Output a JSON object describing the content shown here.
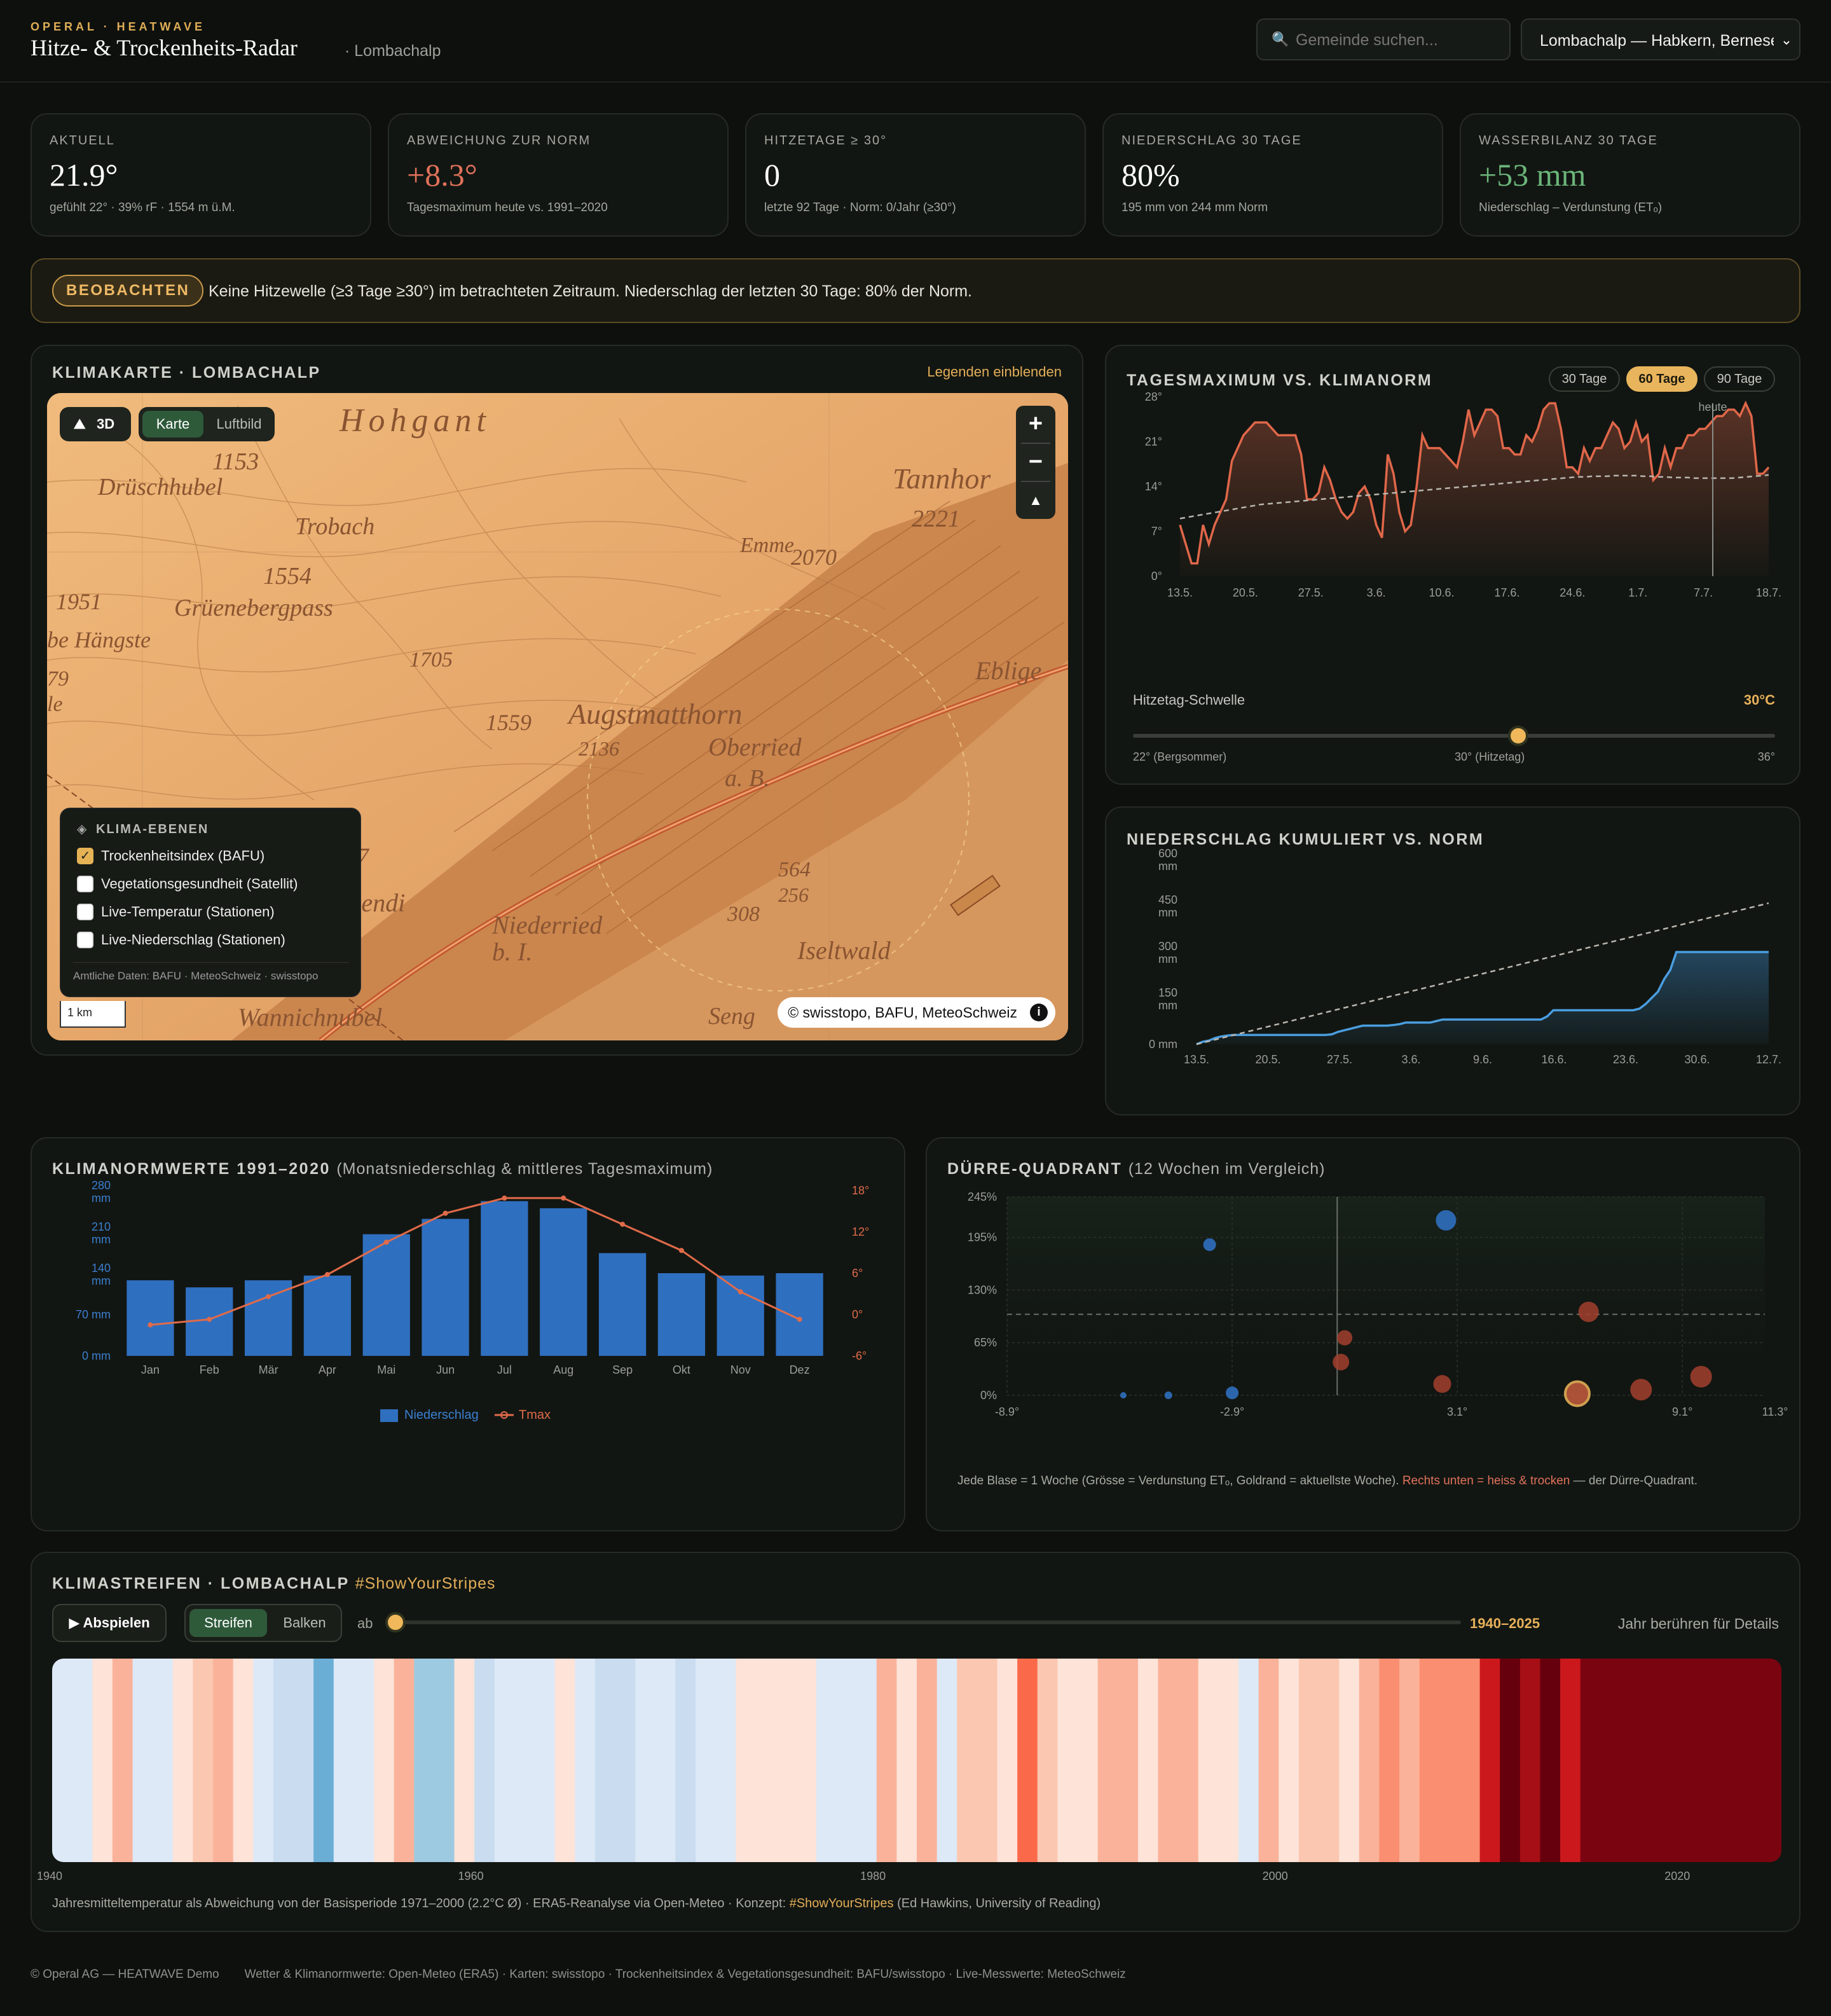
{
  "header": {
    "eyebrow": "OPERAL · HEATWAVE",
    "title": "Hitze- & Trockenheits-Radar",
    "subtitle": "· Lombachalp",
    "search_placeholder": "Gemeinde suchen...",
    "location_value": "Lombachalp — Habkern, Bernese"
  },
  "kpis": [
    {
      "label": "AKTUELL",
      "value": "21.9°",
      "note": "gefühlt 22° · 39% rF · 1554 m ü.M.",
      "color": "#ffffff"
    },
    {
      "label": "ABWEICHUNG ZUR NORM",
      "value": "+8.3°",
      "note": "Tagesmaximum heute vs. 1991–2020",
      "color": "#e0725a"
    },
    {
      "label": "HITZETAGE ≥ 30°",
      "value": "0",
      "note": "letzte 92 Tage · Norm: 0/Jahr (≥30°)",
      "color": "#ffffff"
    },
    {
      "label": "NIEDERSCHLAG 30 TAGE",
      "value": "80%",
      "note": "195 mm von 244 mm Norm",
      "color": "#ffffff"
    },
    {
      "label": "WASSERBILANZ 30 TAGE",
      "value": "+53 mm",
      "note": "Niederschlag – Verdunstung (ETₒ)",
      "color": "#6bb57a"
    }
  ],
  "alert": {
    "badge": "BEOBACHTEN",
    "text": "Keine Hitzewelle (≥3 Tage ≥30°) im betrachteten Zeitraum. Niederschlag der letzten 30 Tage: 80% der Norm."
  },
  "map": {
    "title": "KLIMAKARTE · LOMBACHALP",
    "legend_link": "Legenden einblenden",
    "btn_3d": "3D",
    "mode_map": "Karte",
    "mode_aerial": "Luftbild",
    "zoom_in": "+",
    "zoom_out": "−",
    "layers_title": "KLIMA-EBENEN",
    "layers": [
      {
        "label": "Trockenheitsindex (BAFU)",
        "checked": true
      },
      {
        "label": "Vegetationsgesundheit (Satellit)",
        "checked": false
      },
      {
        "label": "Live-Temperatur (Stationen)",
        "checked": false
      },
      {
        "label": "Live-Niederschlag (Stationen)",
        "checked": false
      }
    ],
    "layers_source": "Amtliche Daten: BAFU · MeteoSchweiz · swisstopo",
    "scale": "1 km",
    "attribution": "© swisstopo, BAFU, MeteoSchweiz",
    "info": "i",
    "places": [
      {
        "t": "Hohgant"
      },
      {
        "t": "1153"
      },
      {
        "t": "Drüschhubel"
      },
      {
        "t": "Trobach"
      },
      {
        "t": "1554"
      },
      {
        "t": "1951"
      },
      {
        "t": "Grüenebergpass"
      },
      {
        "t": "be Hängste"
      },
      {
        "t": "1705"
      },
      {
        "t": "1559"
      },
      {
        "t": "Augstmatthorn"
      },
      {
        "t": "2136"
      },
      {
        "t": "Oberried"
      },
      {
        "t": "a. B."
      },
      {
        "t": "Eblige"
      },
      {
        "t": "Emme"
      },
      {
        "t": "2221"
      },
      {
        "t": "2070"
      },
      {
        "t": "Tannhor"
      },
      {
        "t": "564"
      },
      {
        "t": "256"
      },
      {
        "t": "308"
      },
      {
        "t": "Niederried"
      },
      {
        "t": "b. I."
      },
      {
        "t": "Iseltwald"
      },
      {
        "t": "Wannichnubel"
      },
      {
        "t": "Seng"
      },
      {
        "t": "chwendi"
      },
      {
        "t": "67"
      },
      {
        "t": "79"
      },
      {
        "t": "le"
      }
    ]
  },
  "tmax": {
    "title": "TAGESMAXIMUM VS. KLIMANORM",
    "ranges": [
      "30 Tage",
      "60 Tage",
      "90 Tage"
    ],
    "active_range": "60 Tage",
    "today_label": "heute",
    "threshold_label": "Hitzetag-Schwelle",
    "threshold_value": "30°C",
    "slider_min": "22° (Bergsommer)",
    "slider_mid": "30° (Hitzetag)",
    "slider_max": "36°",
    "slider_fraction": 0.6
  },
  "precip": {
    "title": "NIEDERSCHLAG KUMULIERT VS. NORM"
  },
  "climate": {
    "title": "KLIMANORMWERTE 1991–2020",
    "subtitle": "(Monatsniederschlag & mittleres Tagesmaximum)",
    "legend_precip": "Niederschlag",
    "legend_tmax": "Tmax"
  },
  "drought": {
    "title": "DÜRRE-QUADRANT",
    "subtitle": "(12 Wochen im Vergleich)",
    "note_a": "Jede Blase = 1 Woche (Grösse = Verdunstung ETₒ, Goldrand = aktuellste Woche).",
    "note_b": "Rechts unten = heiss & trocken",
    "note_c": "— der Dürre-Quadrant."
  },
  "stripes": {
    "title": "KLIMASTREIFEN · LOMBACHALP",
    "hashtag": "#ShowYourStripes",
    "play": "▶ Abspielen",
    "mode_stripes": "Streifen",
    "mode_bars": "Balken",
    "from": "ab",
    "range": "1940–2025",
    "hint": "Jahr berühren für Details",
    "years": [
      "1940",
      "1960",
      "1980",
      "2000",
      "2020"
    ],
    "caption_a": "Jahresmitteltemperatur als Abweichung von der Basisperiode 1971–2000 (2.2°C Ø) · ERA5-Reanalyse via Open-Meteo · Konzept: ",
    "caption_b": "#ShowYourStripes",
    "caption_c": " (Ed Hawkins, University of Reading)"
  },
  "footer": {
    "brand": "© Operal AG — HEATWAVE Demo",
    "sources": "Wetter & Klimanormwerte: Open-Meteo (ERA5) · Karten: swisstopo · Trockenheitsindex & Vegetationsgesundheit: BAFU/swisstopo · Live-Messwerte: MeteoSchweiz"
  },
  "chart_data": [
    {
      "id": "tmax",
      "type": "line",
      "title": "TAGESMAXIMUM VS. KLIMANORM",
      "x_ticks": [
        "13.5.",
        "20.5.",
        "27.5.",
        "3.6.",
        "10.6.",
        "17.6.",
        "24.6.",
        "1.7.",
        "7.7.",
        "18.7."
      ],
      "y_ticks": [
        "28°",
        "21°",
        "14°",
        "7°",
        "0°"
      ],
      "ylim": [
        0,
        28
      ],
      "series": [
        {
          "values": [
            8,
            5,
            2,
            2,
            8,
            5,
            8,
            10,
            12,
            18,
            20,
            22,
            23,
            24,
            24,
            24,
            23,
            22,
            22,
            22,
            22,
            19,
            12,
            12,
            13,
            17,
            15,
            12,
            10,
            9,
            10,
            13,
            14,
            12,
            8,
            6,
            19,
            16,
            10,
            7,
            8,
            14,
            22,
            20,
            20,
            20,
            19,
            18,
            17,
            21,
            26,
            22,
            24,
            26,
            26,
            25,
            20,
            20,
            19,
            19,
            22,
            21,
            23,
            26,
            27,
            27,
            23,
            17,
            17,
            16,
            20,
            18,
            20,
            20,
            22,
            24,
            23,
            20,
            21,
            24,
            21,
            22,
            15,
            16,
            20,
            17,
            20,
            20,
            22,
            22,
            23,
            23,
            24,
            25,
            25,
            26,
            26,
            25,
            27,
            25,
            16,
            16,
            17
          ]
        },
        {
          "values": [
            9,
            9.2,
            9.4,
            9.6,
            9.8,
            10,
            10.2,
            10.4,
            10.6,
            10.8,
            11,
            11.2,
            11.3,
            11.4,
            11.5,
            11.6,
            11.7,
            11.8,
            11.9,
            12,
            12.1,
            12.2,
            12.3,
            12.4,
            12.5,
            12.6,
            12.7,
            12.8,
            12.9,
            13,
            13.1,
            13.2,
            13.3,
            13.4,
            13.5,
            13.6,
            13.7,
            13.8,
            13.9,
            14,
            14.1,
            14.2,
            14.3,
            14.4,
            14.5,
            14.6,
            14.7,
            14.8,
            14.9,
            15,
            15.1,
            15.2,
            15.3,
            15.4,
            15.5,
            15.5,
            15.6,
            15.6,
            15.6,
            15.7,
            15.7,
            15.7,
            15.7,
            15.6,
            15.6,
            15.5,
            15.5,
            15.4,
            15.4,
            15.4,
            15.3,
            15.3,
            15.3,
            15.3,
            15.3,
            15.3,
            15.4,
            15.5,
            15.6,
            15.7,
            15.8
          ]
        }
      ]
    },
    {
      "id": "precip",
      "type": "area",
      "title": "NIEDERSCHLAG KUMULIERT VS. NORM",
      "x_ticks": [
        "13.5.",
        "20.5.",
        "27.5.",
        "3.6.",
        "9.6.",
        "16.6.",
        "23.6.",
        "30.6.",
        "12.7."
      ],
      "y_ticks": [
        "600 mm",
        "450 mm",
        "300 mm",
        "150 mm",
        "0 mm"
      ],
      "ylim": [
        0,
        600
      ],
      "series": [
        {
          "values": [
            0,
            8,
            12,
            20,
            25,
            28,
            30,
            30,
            30,
            30,
            30,
            30,
            30,
            30,
            30,
            30,
            30,
            30,
            30,
            30,
            30,
            30,
            32,
            40,
            45,
            50,
            55,
            60,
            60,
            60,
            60,
            60,
            62,
            65,
            70,
            70,
            70,
            70,
            70,
            75,
            80,
            80,
            80,
            80,
            80,
            80,
            80,
            80,
            80,
            80,
            80,
            80,
            80,
            80,
            80,
            80,
            80,
            90,
            110,
            110,
            110,
            110,
            110,
            110,
            110,
            110,
            110,
            110,
            110,
            110,
            110,
            110,
            115,
            130,
            150,
            170,
            210,
            240,
            298,
            298,
            298,
            298,
            298,
            298,
            298,
            298,
            298,
            298,
            298,
            298,
            298,
            298,
            298,
            298
          ]
        },
        {
          "values": [
            0,
            456
          ]
        }
      ]
    },
    {
      "id": "climate",
      "type": "bar",
      "title": "KLIMANORMWERTE 1991–2020",
      "categories": [
        "Jan",
        "Feb",
        "Mär",
        "Apr",
        "Mai",
        "Jun",
        "Jul",
        "Aug",
        "Sep",
        "Okt",
        "Nov",
        "Dez"
      ],
      "y_ticks": [
        "280 mm",
        "210 mm",
        "140 mm",
        "70 mm",
        "0 mm"
      ],
      "y2_ticks": [
        "18°",
        "12°",
        "6°",
        "0°",
        "-6°"
      ],
      "series": [
        {
          "name": "Niederschlag",
          "values": [
            128,
            116,
            128,
            136,
            206,
            232,
            262,
            250,
            174,
            140,
            136,
            140
          ]
        },
        {
          "name": "Tmax",
          "values": [
            -1.5,
            -0.7,
            2.6,
            5.8,
            10.5,
            14.7,
            16.9,
            16.9,
            13.1,
            9.3,
            3.3,
            -0.7
          ]
        }
      ]
    },
    {
      "id": "drought",
      "type": "scatter",
      "title": "DÜRRE-QUADRANT",
      "x_ticks": [
        "-8.9°",
        "-2.9°",
        "3.1°",
        "9.1°",
        "11.3°"
      ],
      "y_ticks": [
        "245%",
        "195%",
        "130%",
        "65%",
        "0%"
      ],
      "series": [
        {
          "values": [
            {
              "x": -5.8,
              "y": 0,
              "r": 5
            },
            {
              "x": -4.6,
              "y": 0,
              "r": 6
            },
            {
              "x": -3.5,
              "y": 186,
              "r": 10
            },
            {
              "x": -2.9,
              "y": 3,
              "r": 10
            },
            {
              "x": 0.1,
              "y": 71,
              "r": 12
            },
            {
              "x": 0.0,
              "y": 41,
              "r": 13
            },
            {
              "x": 2.8,
              "y": 216,
              "r": 16
            },
            {
              "x": 2.7,
              "y": 14,
              "r": 14
            },
            {
              "x": 6.6,
              "y": 103,
              "r": 16
            },
            {
              "x": 6.3,
              "y": 2,
              "r": 19
            },
            {
              "x": 8.0,
              "y": 7,
              "r": 17
            },
            {
              "x": 9.6,
              "y": 23,
              "r": 17
            }
          ]
        }
      ]
    },
    {
      "id": "stripes",
      "type": "heatmap",
      "title": "KLIMASTREIFEN · LOMBACHALP",
      "x_ticks": [
        "1940",
        "1960",
        "1980",
        "2000",
        "2020"
      ],
      "series": [
        {
          "name": "colors",
          "values": [
            "#dde9f6",
            "#dde9f6",
            "#fde3d8",
            "#fbb29a",
            "#dde9f6",
            "#dde9f6",
            "#fde3d8",
            "#fbc7b0",
            "#fbb29a",
            "#fde3d8",
            "#dde9f6",
            "#c9dcf0",
            "#c9dcf0",
            "#6aaed6",
            "#dde9f6",
            "#dde9f6",
            "#fde3d8",
            "#fbb29a",
            "#9ecae1",
            "#9ecae1",
            "#fde3d8",
            "#c9dcf0",
            "#dde9f6",
            "#dde9f6",
            "#dde9f6",
            "#fde3d8",
            "#dde9f6",
            "#c9dcf0",
            "#c9dcf0",
            "#dde9f6",
            "#dde9f6",
            "#c9dcf0",
            "#dde9f6",
            "#dde9f6",
            "#fde3d8",
            "#fde3d8",
            "#fde3d8",
            "#fde3d8",
            "#dde9f6",
            "#dde9f6",
            "#dde9f6",
            "#fbb29a",
            "#fde3d8",
            "#fbb29a",
            "#dde9f6",
            "#fbc7b0",
            "#fbc7b0",
            "#fde3d8",
            "#fa6a4a",
            "#fbc7b0",
            "#fde3d8",
            "#fde3d8",
            "#fbb29a",
            "#fbb29a",
            "#fde3d8",
            "#fbb29a",
            "#fbb29a",
            "#fde3d8",
            "#fde3d8",
            "#dde9f6",
            "#fbb29a",
            "#fde3d8",
            "#fbc7b0",
            "#fbc7b0",
            "#fde3d8",
            "#fbb29a",
            "#fa8e71",
            "#fbb29a",
            "#fa8e71",
            "#fa8e71",
            "#fa8e71",
            "#cb181d",
            "#67000d",
            "#a50f15",
            "#67000d",
            "#cb181d",
            "#7a0510",
            "#7a0510",
            "#7a0510",
            "#7a0510",
            "#7a0510",
            "#7a0510",
            "#7a0510",
            "#7a0510",
            "#7a0510",
            "#7a0510"
          ]
        }
      ]
    }
  ]
}
